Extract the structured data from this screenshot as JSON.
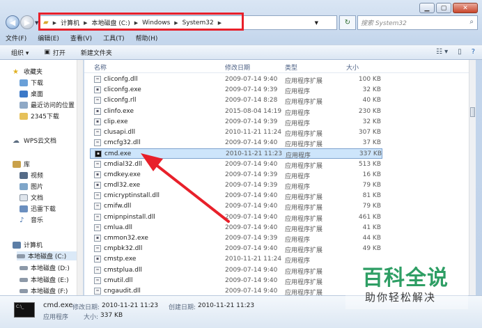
{
  "address": {
    "crumbs": [
      "计算机",
      "本地磁盘 (C:)",
      "Windows",
      "System32"
    ],
    "search_placeholder": "搜索 System32"
  },
  "menu": [
    "文件(F)",
    "编辑(E)",
    "查看(V)",
    "工具(T)",
    "帮助(H)"
  ],
  "toolbar": {
    "organize": "组织 ▾",
    "open": "打开",
    "new_folder": "新建文件夹"
  },
  "navpane": {
    "favorites": "收藏夹",
    "fav_items": [
      "下载",
      "桌面",
      "最近访问的位置",
      "2345下载"
    ],
    "wps": "WPS云文档",
    "libraries": "库",
    "lib_items": [
      "视频",
      "图片",
      "文档",
      "迅雷下载",
      "音乐"
    ],
    "computer": "计算机",
    "drives": [
      "本地磁盘 (C:)",
      "本地磁盘 (D:)",
      "本地磁盘 (E:)",
      "本地磁盘 (F:)"
    ]
  },
  "columns": {
    "name": "名称",
    "date": "修改日期",
    "type": "类型",
    "size": "大小"
  },
  "files": [
    {
      "name": "cliconfg.dll",
      "date": "2009-07-14 9:40",
      "type": "应用程序扩展",
      "size": "100 KB"
    },
    {
      "name": "cliconfg.exe",
      "date": "2009-07-14 9:39",
      "type": "应用程序",
      "size": "32 KB"
    },
    {
      "name": "cliconfg.rll",
      "date": "2009-07-14 8:28",
      "type": "应用程序扩展",
      "size": "40 KB"
    },
    {
      "name": "clinfo.exe",
      "date": "2015-08-04 14:19",
      "type": "应用程序",
      "size": "230 KB"
    },
    {
      "name": "clip.exe",
      "date": "2009-07-14 9:39",
      "type": "应用程序",
      "size": "32 KB"
    },
    {
      "name": "clusapi.dll",
      "date": "2010-11-21 11:24",
      "type": "应用程序扩展",
      "size": "307 KB"
    },
    {
      "name": "cmcfg32.dll",
      "date": "2009-07-14 9:40",
      "type": "应用程序扩展",
      "size": "37 KB"
    },
    {
      "name": "cmd.exe",
      "date": "2010-11-21 11:23",
      "type": "应用程序",
      "size": "337 KB"
    },
    {
      "name": "cmdial32.dll",
      "date": "2009-07-14 9:40",
      "type": "应用程序扩展",
      "size": "513 KB"
    },
    {
      "name": "cmdkey.exe",
      "date": "2009-07-14 9:39",
      "type": "应用程序",
      "size": "16 KB"
    },
    {
      "name": "cmdl32.exe",
      "date": "2009-07-14 9:39",
      "type": "应用程序",
      "size": "79 KB"
    },
    {
      "name": "cmicryptinstall.dll",
      "date": "2009-07-14 9:40",
      "type": "应用程序扩展",
      "size": "81 KB"
    },
    {
      "name": "cmifw.dll",
      "date": "2009-07-14 9:40",
      "type": "应用程序扩展",
      "size": "79 KB"
    },
    {
      "name": "cmipnpinstall.dll",
      "date": "2009-07-14 9:40",
      "type": "应用程序扩展",
      "size": "461 KB"
    },
    {
      "name": "cmlua.dll",
      "date": "2009-07-14 9:40",
      "type": "应用程序扩展",
      "size": "41 KB"
    },
    {
      "name": "cmmon32.exe",
      "date": "2009-07-14 9:39",
      "type": "应用程序",
      "size": "44 KB"
    },
    {
      "name": "cmpbk32.dll",
      "date": "2009-07-14 9:40",
      "type": "应用程序扩展",
      "size": "49 KB"
    },
    {
      "name": "cmstp.exe",
      "date": "2010-11-21 11:24",
      "type": "应用程序",
      "size": ""
    },
    {
      "name": "cmstplua.dll",
      "date": "2009-07-14 9:40",
      "type": "应用程序扩展",
      "size": ""
    },
    {
      "name": "cmutil.dll",
      "date": "2009-07-14 9:40",
      "type": "应用程序扩展",
      "size": ""
    },
    {
      "name": "cngaudit.dll",
      "date": "2009-07-14 9:40",
      "type": "应用程序扩展",
      "size": ""
    }
  ],
  "details": {
    "name": "cmd.exe",
    "mod_label": "修改日期:",
    "mod_value": "2010-11-21 11:23",
    "created_label": "创建日期:",
    "created_value": "2010-11-21 11:23",
    "type": "应用程序",
    "size_label": "大小:",
    "size_value": "337 KB"
  },
  "watermark": {
    "logo": "百科全说",
    "sub": "助你轻松解决"
  },
  "colors": {
    "highlight": "#e8202a",
    "selection": "#cde5fb",
    "brand_green": "#2e9e64"
  }
}
